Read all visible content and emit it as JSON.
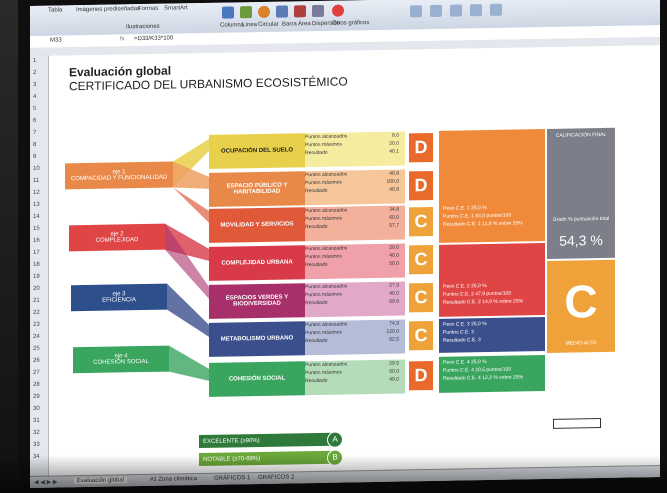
{
  "ribbon": {
    "cell_ref": "M33",
    "formula": "=D33/K33*100",
    "items": [
      "Tabla",
      "Imágenes prediseñadas",
      "Formas",
      "SmartArt",
      "Columna",
      "Línea",
      "Circular",
      "Barra",
      "Área",
      "Dispersión",
      "Otros gráficos"
    ],
    "group": "Ilustraciones"
  },
  "sheet": {
    "title": "Evaluación global",
    "subtitle": "CERTIFICADO DEL URBANISMO ECOSISTÉMICO",
    "row_numbers": [
      "1",
      "2",
      "3",
      "4",
      "5",
      "6",
      "7",
      "8",
      "9",
      "10",
      "11",
      "12",
      "13",
      "14",
      "15",
      "16",
      "17",
      "18",
      "19",
      "20",
      "21",
      "22",
      "23",
      "24",
      "25",
      "26",
      "27",
      "28",
      "29",
      "30",
      "31",
      "32",
      "33",
      "34"
    ]
  },
  "ejes": [
    {
      "num": "eje 1",
      "name": "COMPACIDAD Y FUNCIONALIDAD",
      "color": "#e8894a"
    },
    {
      "num": "eje 2",
      "name": "COMPLEJIDAD",
      "color": "#e04545"
    },
    {
      "num": "eje 3",
      "name": "EFICIENCIA",
      "color": "#2d4f8c"
    },
    {
      "num": "eje 4",
      "name": "COHESIÓN SOCIAL",
      "color": "#3aa55f"
    }
  ],
  "indicators": [
    {
      "name": "OCUPACIÓN DEL SUELO",
      "color": "#e9d04a",
      "band": "#f6eca0",
      "alcanzados": "8,0",
      "maximos": "20,0",
      "resultado": "40,1",
      "grade": "D",
      "grade_color": "#e96a2a"
    },
    {
      "name": "ESPACIO PÚBLICO Y HABITABILIDAD",
      "color": "#e8894a",
      "band": "#f6c69a",
      "alcanzados": "40,8",
      "maximos": "100,0",
      "resultado": "40,8",
      "grade": "D",
      "grade_color": "#e96a2a"
    },
    {
      "name": "MOVILIDAD Y SERVICIOS",
      "color": "#e05a3a",
      "band": "#f3b09a",
      "alcanzados": "34,8",
      "maximos": "60,0",
      "resultado": "57,7",
      "grade": "C",
      "grade_color": "#f0a23a"
    },
    {
      "name": "COMPLEJIDAD URBANA",
      "color": "#d83a4a",
      "band": "#f0a0a8",
      "alcanzados": "20,0",
      "maximos": "40,0",
      "resultado": "50,0",
      "grade": "C",
      "grade_color": "#f0a23a"
    },
    {
      "name": "ESPACIOS VERDES Y BIODIVERSIDAD",
      "color": "#a8306a",
      "band": "#e2a8c8",
      "alcanzados": "27,9",
      "maximos": "40,0",
      "resultado": "69,8",
      "grade": "C",
      "grade_color": "#f0a23a"
    },
    {
      "name": "METABOLISMO URBANO",
      "color": "#3a4f8c",
      "band": "#b4bcd8",
      "alcanzados": "74,9",
      "maximos": "120,0",
      "resultado": "62,5",
      "grade": "C",
      "grade_color": "#f0a23a"
    },
    {
      "name": "COHESIÓN SOCIAL",
      "color": "#3aa55f",
      "band": "#b5dcb8",
      "alcanzados": "29,5",
      "maximos": "60,0",
      "resultado": "49,0",
      "grade": "D",
      "grade_color": "#e96a2a"
    }
  ],
  "point_labels": {
    "alcanzados": "Puntos alcanzados",
    "maximos": "Puntos máximos",
    "resultado": "Resultado"
  },
  "summary": [
    {
      "p1": "Peso C.E. 1",
      "v1": "25,0 %",
      "p2": "Puntos C.E. 1",
      "v2": "83,0 puntos/100",
      "p3": "Resultado C.E. 1",
      "v3": "11,8 % sobre 25%",
      "color": "#f08a3a"
    },
    {
      "p1": "Peso C.E. 2",
      "v1": "25,0 %",
      "p2": "Puntos C.E. 2",
      "v2": "47,9 puntos/100",
      "p3": "Resultado C.E. 2",
      "v3": "14,9 % sobre 25%",
      "color": "#e04545"
    },
    {
      "p1": "Peso C.E. 3",
      "v1": "25,0 %",
      "p2": "Puntos C.E. 3",
      "v2": "",
      "p3": "Resultado C.E. 3",
      "v3": "",
      "color": "#3a4f8c"
    },
    {
      "p1": "Peso C.E. 4",
      "v1": "25,0 %",
      "p2": "Puntos C.E. 4",
      "v2": "20,5 puntos/100",
      "p3": "Resultado C.E. 4",
      "v3": "12,2 % sobre 25%",
      "color": "#3aa55f"
    }
  ],
  "final": {
    "header": "CALIFICACIÓN FINAL",
    "label": "Grado % puntuación total",
    "score": "54,3 %",
    "grade": "C",
    "footer": "MEDIO-ALTO"
  },
  "scale": [
    {
      "label": "EXCELENTE (≥90%)",
      "badge": "A",
      "color": "#2f7a3a"
    },
    {
      "label": "NOTABLE (≥70-89%)",
      "badge": "B",
      "color": "#6aa83a"
    }
  ],
  "tabs": {
    "first": "Evaluación global",
    "others": [
      "#1 Zona climática",
      "GRÁFICOS 1",
      "GRÁFICOS 2"
    ]
  }
}
